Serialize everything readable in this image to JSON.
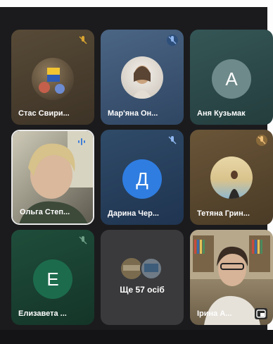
{
  "meeting": {
    "participants": [
      {
        "name": "Стас Свири...",
        "initial": "",
        "muted": true
      },
      {
        "name": "Мар'яна Он...",
        "initial": "",
        "muted": true
      },
      {
        "name": "Аня Кузьмак",
        "initial": "A",
        "muted": false
      },
      {
        "name": "Ольга Степ...",
        "initial": "",
        "muted": false,
        "speaking": true
      },
      {
        "name": "Дарина Чер...",
        "initial": "Д",
        "muted": true
      },
      {
        "name": "Тетяна Грин...",
        "initial": "",
        "muted": true
      },
      {
        "name": "Елизавета ...",
        "initial": "E",
        "muted": true
      },
      {
        "name": "Ірина А...",
        "initial": "",
        "muted": false
      }
    ],
    "more_tile": {
      "label": "Ще 57 осіб"
    }
  },
  "colors": {
    "tile_dark": "#3a3a3c",
    "tile_brown": "#5b4a34",
    "tile_blue": "#3e5876",
    "tile_teal": "#2f4c4c",
    "tile_green": "#1f4a3a",
    "accent_blue": "#2f7de1",
    "muted_yellow": "#d9a531",
    "muted_blue": "#3f7fd6"
  },
  "icons": [
    "mic-muted-icon",
    "speaking-icon",
    "picture-in-picture-icon"
  ]
}
